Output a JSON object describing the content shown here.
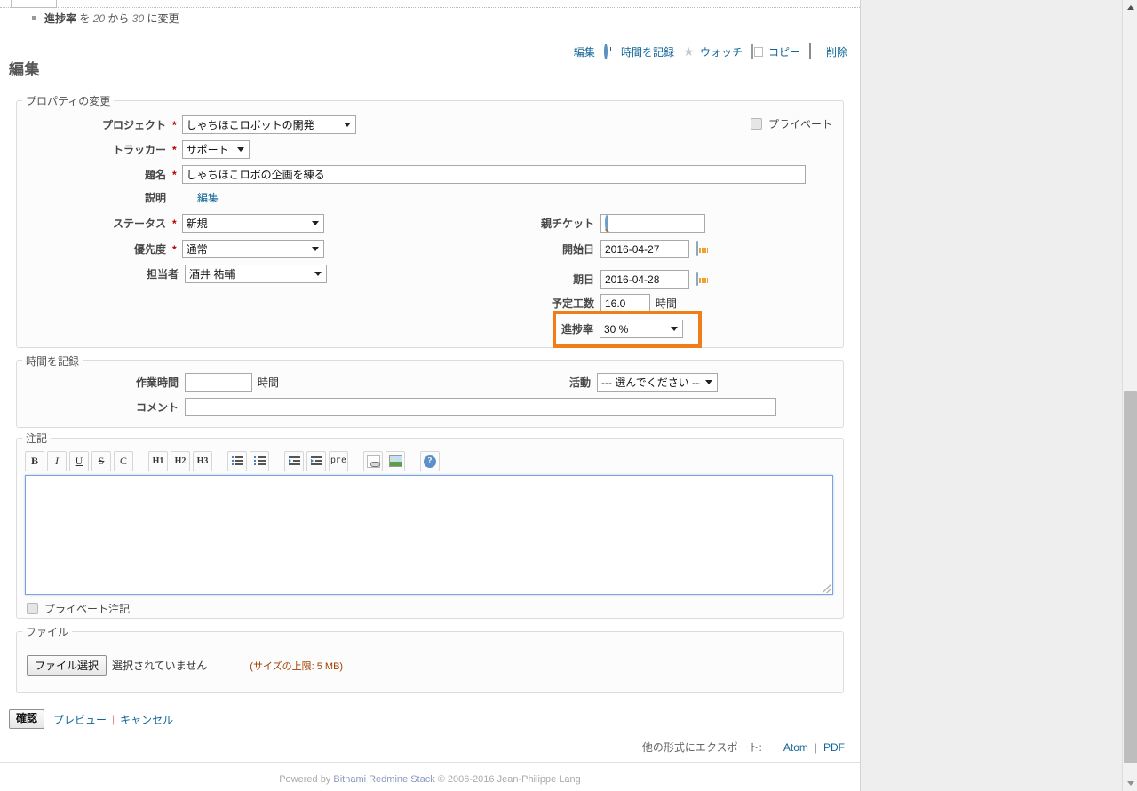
{
  "journal": {
    "detail_label": "進捗率",
    "detail_particle_1": "を",
    "detail_old": "20",
    "detail_particle_2": "から",
    "detail_new": "30",
    "detail_suffix": "に変更"
  },
  "contextual": {
    "edit": "編集",
    "log_time": "時間を記録",
    "watch": "ウォッチ",
    "copy": "コピー",
    "delete": "削除"
  },
  "page": {
    "title": "編集"
  },
  "properties": {
    "legend": "プロパティの変更",
    "project_label": "プロジェクト",
    "project_value": "しゃちほこロボットの開発",
    "tracker_label": "トラッカー",
    "tracker_value": "サポート",
    "subject_label": "題名",
    "subject_value": "しゃちほこロボの企画を練る",
    "description_label": "説明",
    "description_edit_link": "編集",
    "status_label": "ステータス",
    "status_value": "新規",
    "priority_label": "優先度",
    "priority_value": "通常",
    "assignee_label": "担当者",
    "assignee_value": "酒井 祐輔",
    "private_label": "プライベート",
    "parent_task_label": "親チケット",
    "parent_task_value": "",
    "start_date_label": "開始日",
    "start_date_value": "2016-04-27",
    "due_date_label": "期日",
    "due_date_value": "2016-04-28",
    "estimated_hours_label": "予定工数",
    "estimated_hours_value": "16.0",
    "hours_unit": "時間",
    "progress_label": "進捗率",
    "progress_value": "30 %",
    "required_marker": "*"
  },
  "log_time": {
    "legend": "時間を記録",
    "hours_label": "作業時間",
    "hours_value": "",
    "hours_unit": "時間",
    "comment_label": "コメント",
    "comment_value": "",
    "activity_label": "活動",
    "activity_value": "--- 選んでください ---"
  },
  "notes": {
    "legend": "注記",
    "textarea_value": "",
    "private_note_label": "プライベート注記",
    "toolbar": [
      {
        "name": "bold-button",
        "label": "B"
      },
      {
        "name": "italic-button",
        "label": "I"
      },
      {
        "name": "underline-button",
        "label": "U"
      },
      {
        "name": "strikethrough-button",
        "label": "S"
      },
      {
        "name": "code-button",
        "label": "C"
      },
      {
        "name": "heading1-button",
        "label": "H1"
      },
      {
        "name": "heading2-button",
        "label": "H2"
      },
      {
        "name": "heading3-button",
        "label": "H3"
      },
      {
        "name": "unordered-list-button",
        "label": ""
      },
      {
        "name": "ordered-list-button",
        "label": ""
      },
      {
        "name": "outdent-button",
        "label": ""
      },
      {
        "name": "indent-button",
        "label": ""
      },
      {
        "name": "preformatted-button",
        "label": "pre"
      },
      {
        "name": "link-button",
        "label": ""
      },
      {
        "name": "image-button",
        "label": ""
      },
      {
        "name": "help-button",
        "label": "?"
      }
    ]
  },
  "files": {
    "legend": "ファイル",
    "choose_button": "ファイル選択",
    "no_file_text": "選択されていません",
    "size_limit": "(サイズの上限: 5 MB)"
  },
  "submit": {
    "confirm": "確認",
    "preview": "プレビュー",
    "separator": "|",
    "cancel": "キャンセル"
  },
  "export": {
    "label": "他の形式にエクスポート:",
    "atom": "Atom",
    "separator": "|",
    "pdf": "PDF"
  },
  "footer": {
    "powered_by": "Powered by",
    "brand": "Bitnami Redmine Stack",
    "copyright": "© 2006-2016 Jean-Philippe Lang"
  },
  "colors": {
    "highlight": "#ef7e1a",
    "link": "#116699",
    "required": "#bb0000"
  }
}
